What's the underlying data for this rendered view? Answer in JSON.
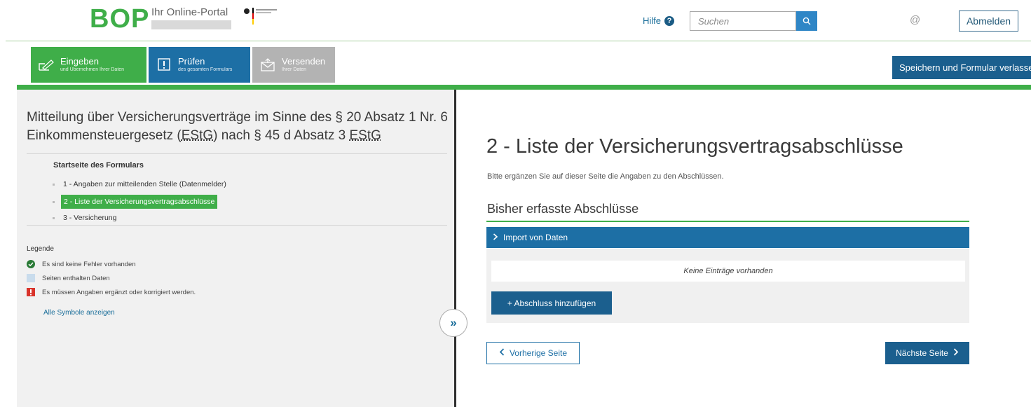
{
  "header": {
    "logo_text": "BOP",
    "portal_name": "Ihr Online-Portal",
    "help_label": "Hilfe",
    "search_placeholder": "Suchen",
    "logout_label": "Abmelden"
  },
  "tabs": [
    {
      "title": "Eingeben",
      "subtitle": "und Übernehmen Ihrer Daten",
      "color": "#3fae49"
    },
    {
      "title": "Prüfen",
      "subtitle": "des gesamten Formulars",
      "color": "#1d6fa5"
    },
    {
      "title": "Versenden",
      "subtitle": "Ihrer Daten",
      "color": "#b3b3b3"
    }
  ],
  "toolbar": {
    "save_label": "Speichern und Formular verlassen"
  },
  "sidebar": {
    "form_title_part1": "Mitteilung über Versicherungsverträge im Sinne des § 20 Absatz 1 Nr. 6 Einkommensteuergesetz (",
    "form_title_abbr1": "EStG",
    "form_title_part2": ") nach § 45 d Absatz 3 ",
    "form_title_abbr2": "EStG",
    "start_label": "Startseite des Formulars",
    "nav_items": [
      {
        "label": "1 - Angaben zur mitteilenden Stelle (Datenmelder)",
        "active": false
      },
      {
        "label": "2 - Liste der Versicherungsvertragsabschlüsse",
        "active": true
      },
      {
        "label": "3 - Versicherung",
        "active": false
      }
    ],
    "legend": {
      "title": "Legende",
      "ok": "Es sind keine Fehler vorhanden",
      "data": "Seiten enthalten Daten",
      "error": "Es müssen Angaben ergänzt oder korrigiert werden.",
      "show_all": "Alle Symbole anzeigen"
    }
  },
  "main": {
    "heading": "2 - Liste der Versicherungsvertragsabschlüsse",
    "intro": "Bitte ergänzen Sie auf dieser Seite die Angaben zu den Abschlüssen.",
    "section_heading": "Bisher erfasste Abschlüsse",
    "import_label": "Import von Daten",
    "empty_text": "Keine Einträge vorhanden",
    "add_label": "+ Abschluss hinzufügen",
    "prev_label": "Vorherige Seite",
    "next_label": "Nächste Seite"
  },
  "colors": {
    "brand_green": "#3fae49",
    "primary_blue": "#1d6fa5",
    "dark_blue": "#1b5f8e",
    "error_red": "#d9342b"
  }
}
